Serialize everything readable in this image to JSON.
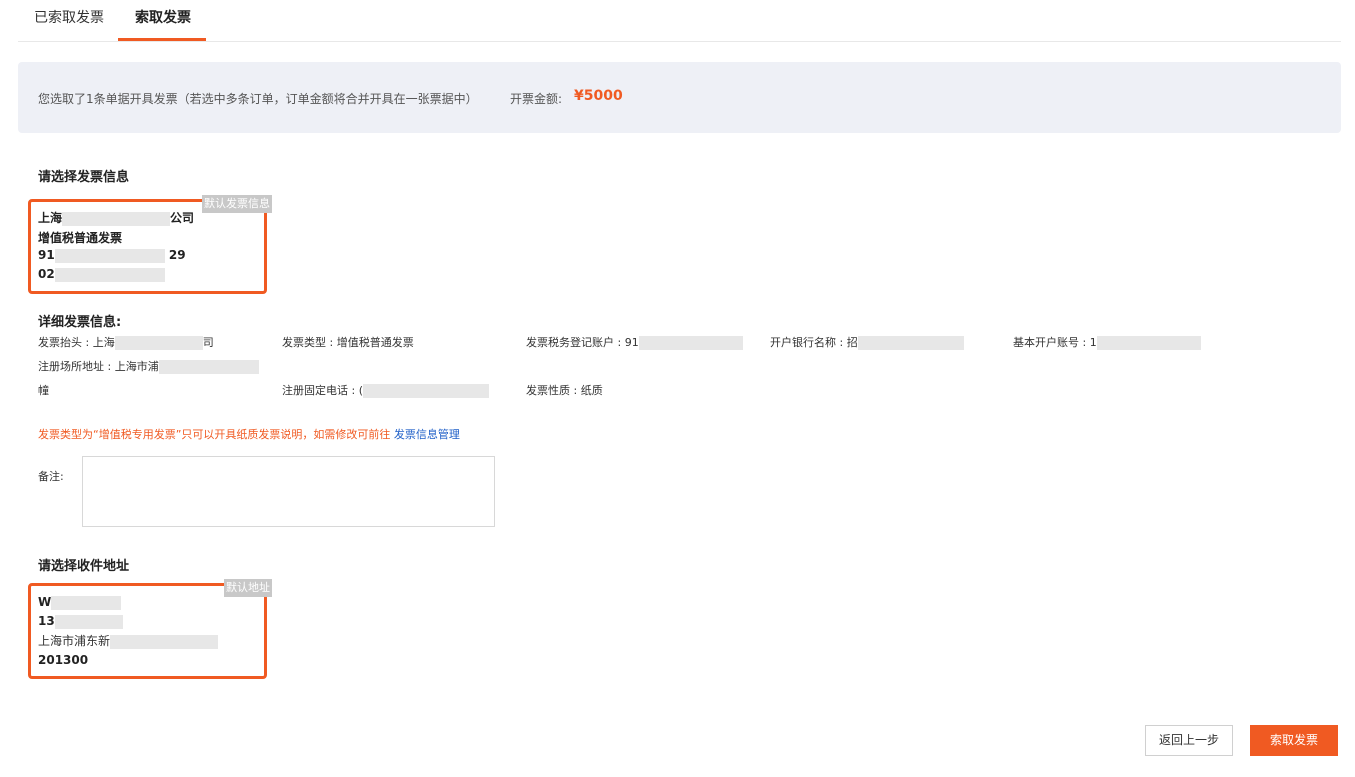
{
  "tabs": [
    {
      "label": "已索取发票"
    },
    {
      "label": "索取发票"
    }
  ],
  "banner": {
    "message": "您选取了1条单据开具发票（若选中多条订单，订单金额将合并开具在一张票据中）",
    "amount_label": "开票金额:",
    "amount": "¥5000"
  },
  "invoice_section": {
    "title": "请选择发票信息",
    "card": {
      "badge": "默认发票信息",
      "line1_prefix": "上海",
      "line1_suffix": "公司",
      "line2": "增值税普通发票",
      "line3_prefix": "91",
      "line3_suffix": "29",
      "line4_prefix": "02"
    }
  },
  "details": {
    "title": "详细发票信息:",
    "title_label": "发票抬头 : 上海",
    "title_suffix": "司",
    "type": "发票类型 : 增值税普通发票",
    "tax_account": "发票税务登记账户 : 91",
    "bank_name": "开户银行名称 : 招",
    "bank_account": "基本开户账号 : 1",
    "reg_address": "注册场所地址 : 上海市浦",
    "reg_address_cont": "幢",
    "reg_phone": "注册固定电话 : (",
    "nature": "发票性质 : 纸质"
  },
  "notice": {
    "text": "发票类型为“增值税专用发票”只可以开具纸质发票说明，如需修改可前往 ",
    "link": "发票信息管理"
  },
  "remark": {
    "label": "备注:",
    "value": ""
  },
  "address_section": {
    "title": "请选择收件地址",
    "card": {
      "badge": "默认地址",
      "name_prefix": "W",
      "phone_prefix": "13",
      "address_prefix": "上海市浦东新",
      "zip": "201300"
    }
  },
  "buttons": {
    "back": "返回上一步",
    "submit": "索取发票"
  },
  "colors": {
    "accent": "#f05a22",
    "link": "#2060c8",
    "banner_bg": "#eef0f6"
  }
}
